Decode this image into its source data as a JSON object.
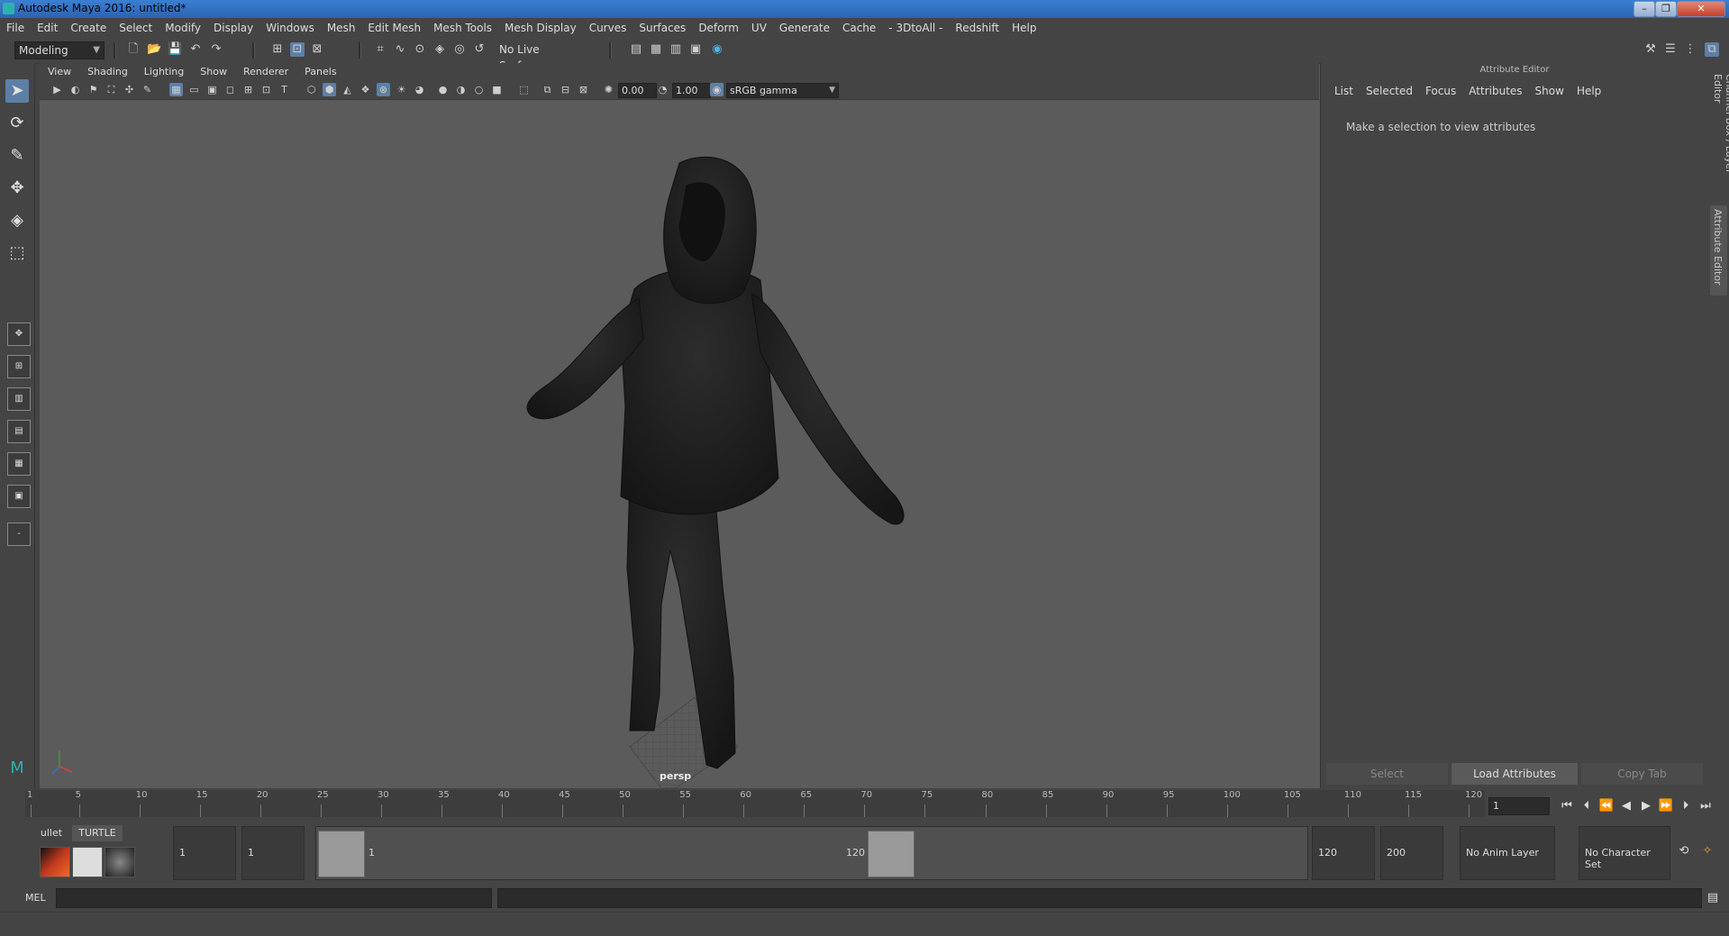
{
  "window": {
    "title": "Autodesk Maya 2016: untitled*",
    "controls": [
      "–",
      "❐",
      "✕"
    ]
  },
  "menubar": [
    "File",
    "Edit",
    "Create",
    "Select",
    "Modify",
    "Display",
    "Windows",
    "Mesh",
    "Edit Mesh",
    "Mesh Tools",
    "Mesh Display",
    "Curves",
    "Surfaces",
    "Deform",
    "UV",
    "Generate",
    "Cache",
    "- 3DtoAll -",
    "Redshift",
    "Help"
  ],
  "toolbar": {
    "mode": "Modeling",
    "live_surface": "No Live Surface"
  },
  "viewport": {
    "menu": [
      "View",
      "Shading",
      "Lighting",
      "Show",
      "Renderer",
      "Panels"
    ],
    "exposure": "0.00",
    "gamma": "1.00",
    "color_space": "sRGB gamma",
    "camera_label": "persp"
  },
  "attribute_editor": {
    "header": "Attribute Editor",
    "menu": [
      "List",
      "Selected",
      "Focus",
      "Attributes",
      "Show",
      "Help"
    ],
    "message": "Make a selection to view attributes",
    "buttons": {
      "select": "Select",
      "load": "Load Attributes",
      "copy": "Copy Tab"
    },
    "side_tabs": [
      "Channel Box / Layer Editor",
      "Attribute Editor"
    ]
  },
  "timeline": {
    "ticks": [
      "1",
      "5",
      "10",
      "15",
      "20",
      "25",
      "30",
      "35",
      "40",
      "45",
      "50",
      "55",
      "60",
      "65",
      "70",
      "75",
      "80",
      "85",
      "90",
      "95",
      "100",
      "105",
      "110",
      "115",
      "120"
    ],
    "current_frame": "1"
  },
  "range": {
    "start_anim": "1",
    "start_playback": "1",
    "handle_start": "1",
    "handle_end": "120",
    "end_playback": "120",
    "end_anim": "200",
    "anim_layer": "No Anim Layer",
    "character_set": "No Character Set"
  },
  "shelf": {
    "tabs": [
      "ullet",
      "TURTLE"
    ]
  },
  "command_line": {
    "label": "MEL"
  }
}
